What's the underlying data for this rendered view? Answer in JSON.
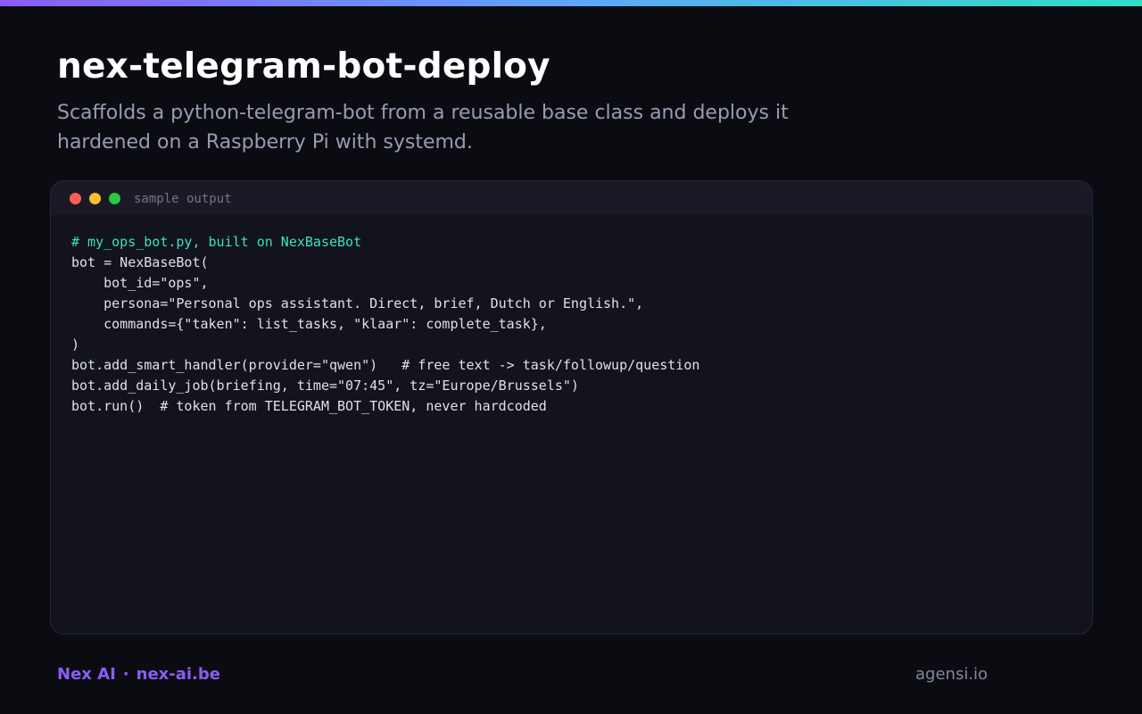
{
  "colors": {
    "gradient_start": "#8b5cf6",
    "gradient_mid": "#60a5fa",
    "gradient_end": "#2de0c4",
    "background": "#0b0c11",
    "comment": "#3fe0bd",
    "brand": "#8b5cf6",
    "dot_red": "#ff5f57",
    "dot_yellow": "#febc2e",
    "dot_green": "#28c840"
  },
  "header": {
    "title": "nex-telegram-bot-deploy",
    "subtitle": "Scaffolds a python-telegram-bot from a reusable base class and deploys it hardened on a Raspberry Pi with systemd."
  },
  "terminal": {
    "label": "sample output",
    "window_controls": [
      "close-dot",
      "minimize-dot",
      "maximize-dot"
    ],
    "lines": [
      "# my_ops_bot.py, built on NexBaseBot",
      "bot = NexBaseBot(",
      "    bot_id=\"ops\",",
      "    persona=\"Personal ops assistant. Direct, brief, Dutch or English.\",",
      "    commands={\"taken\": list_tasks, \"klaar\": complete_task},",
      ")",
      "bot.add_smart_handler(provider=\"qwen\")   # free text -> task/followup/question",
      "bot.add_daily_job(briefing, time=\"07:45\", tz=\"Europe/Brussels\")",
      "bot.run()  # token from TELEGRAM_BOT_TOKEN, never hardcoded"
    ]
  },
  "footer": {
    "brand_name": "Nex AI",
    "separator": "·",
    "brand_site": "nex-ai.be",
    "right_link": "agensi.io"
  }
}
